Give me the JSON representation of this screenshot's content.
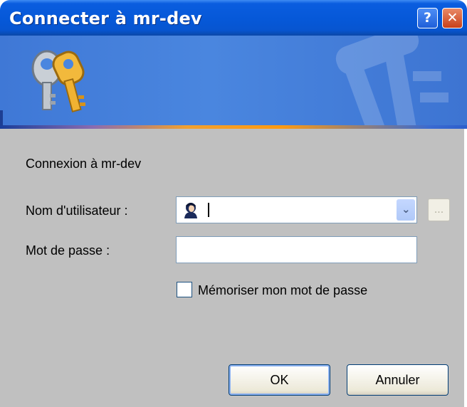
{
  "window": {
    "title": "Connecter à mr-dev",
    "help_label": "?",
    "close_label": "✕"
  },
  "form": {
    "intro": "Connexion à mr-dev",
    "username_label": "Nom d'utilisateur :",
    "username_value": "",
    "browse_label": "...",
    "password_label": "Mot de passe :",
    "password_value": "",
    "remember_label": "Mémoriser mon mot de passe",
    "remember_checked": false
  },
  "buttons": {
    "ok": "OK",
    "cancel": "Annuler"
  },
  "colors": {
    "titlebar": "#0658d8",
    "banner": "#4a86df",
    "body": "#c0c0c0",
    "accent_line": "#ff9a10"
  }
}
